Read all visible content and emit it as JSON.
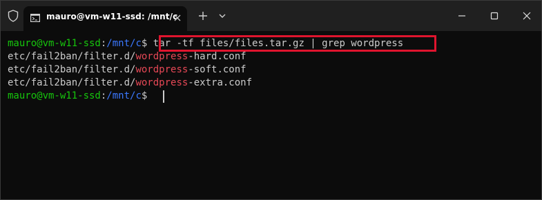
{
  "window": {
    "tab_title": "mauro@vm-w11-ssd: /mnt/c",
    "colors": {
      "titlebar": "#202020",
      "terminal_bg": "#0c0c0c",
      "prompt_user": "#16c60c",
      "prompt_path": "#3b78ff",
      "match_highlight": "#e74856",
      "annotation_box": "#e0142e"
    },
    "icons": {
      "shield": "shield-icon",
      "tab_icon": "terminal-icon",
      "tab_close": "close-icon",
      "new_tab": "plus-icon",
      "dropdown": "chevron-down-icon",
      "minimize": "minimize-icon",
      "maximize": "maximize-icon",
      "close": "close-icon"
    }
  },
  "terminal": {
    "prompt1": {
      "user_host": "mauro@vm-w11-ssd",
      "sep": ":",
      "path": "/mnt/c",
      "symbol": "$ ",
      "command": "tar -tf files/files.tar.gz | grep wordpress"
    },
    "output": [
      {
        "pre": "etc/fail2ban/filter.d/",
        "match": "wordpress",
        "post": "-hard.conf"
      },
      {
        "pre": "etc/fail2ban/filter.d/",
        "match": "wordpress",
        "post": "-soft.conf"
      },
      {
        "pre": "etc/fail2ban/filter.d/",
        "match": "wordpress",
        "post": "-extra.conf"
      }
    ],
    "prompt2": {
      "user_host": "mauro@vm-w11-ssd",
      "sep": ":",
      "path": "/mnt/c",
      "symbol": "$ "
    }
  }
}
